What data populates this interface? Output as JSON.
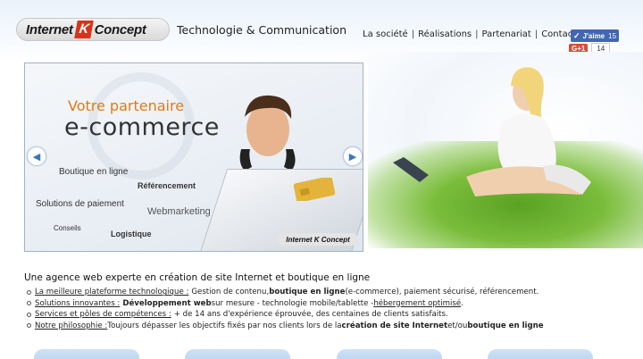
{
  "header": {
    "logo_left": "Internet",
    "logo_k": "K",
    "logo_right": "Concept",
    "tagline": "Technologie & Communication",
    "nav": [
      "La société",
      "Réalisations",
      "Partenariat",
      "Contact"
    ],
    "nav_separator": "|"
  },
  "social": {
    "like_label": "J'aime",
    "like_count": "15",
    "gplus_label": "G+1",
    "gplus_count": "14"
  },
  "slider": {
    "title_line1": "Votre partenaire",
    "title_line2": "e-commerce",
    "keywords": [
      "Boutique en ligne",
      "Référencement",
      "Solutions de paiement",
      "Webmarketing",
      "Conseils",
      "Logistique"
    ],
    "logo_text": "Internet K Concept",
    "prev_icon": "◀",
    "next_icon": "▶"
  },
  "content": {
    "intro": "Une agence web experte en création de site Internet et boutique en ligne",
    "features": [
      {
        "link": "La meilleure plateforme technologique :",
        "parts": [
          "Gestion de contenu, ",
          "boutique en ligne",
          " (e-commerce), paiement sécurisé, référencement."
        ]
      },
      {
        "link": "Solutions innovantes :",
        "parts": [
          "Développement web",
          " sur mesure - technologie mobile/tablette - ",
          "hébergement optimisé",
          "."
        ]
      },
      {
        "link": "Services et pôles de compétences :",
        "parts": [
          "+ de 14 ans d'expérience éprouvée, des centaines de clients satisfaits."
        ]
      },
      {
        "link": "Notre philosophie :",
        "parts": [
          "Toujours dépasser les objectifs fixés par nos clients lors de la ",
          "création de site Internet",
          " et/ou ",
          "boutique en ligne"
        ]
      }
    ]
  },
  "colors": {
    "accent_orange": "#e07b12",
    "logo_red": "#d8331c",
    "facebook_blue": "#4267b2",
    "gplus_red": "#dd4b39",
    "box_blue": "#b3d0ee"
  }
}
